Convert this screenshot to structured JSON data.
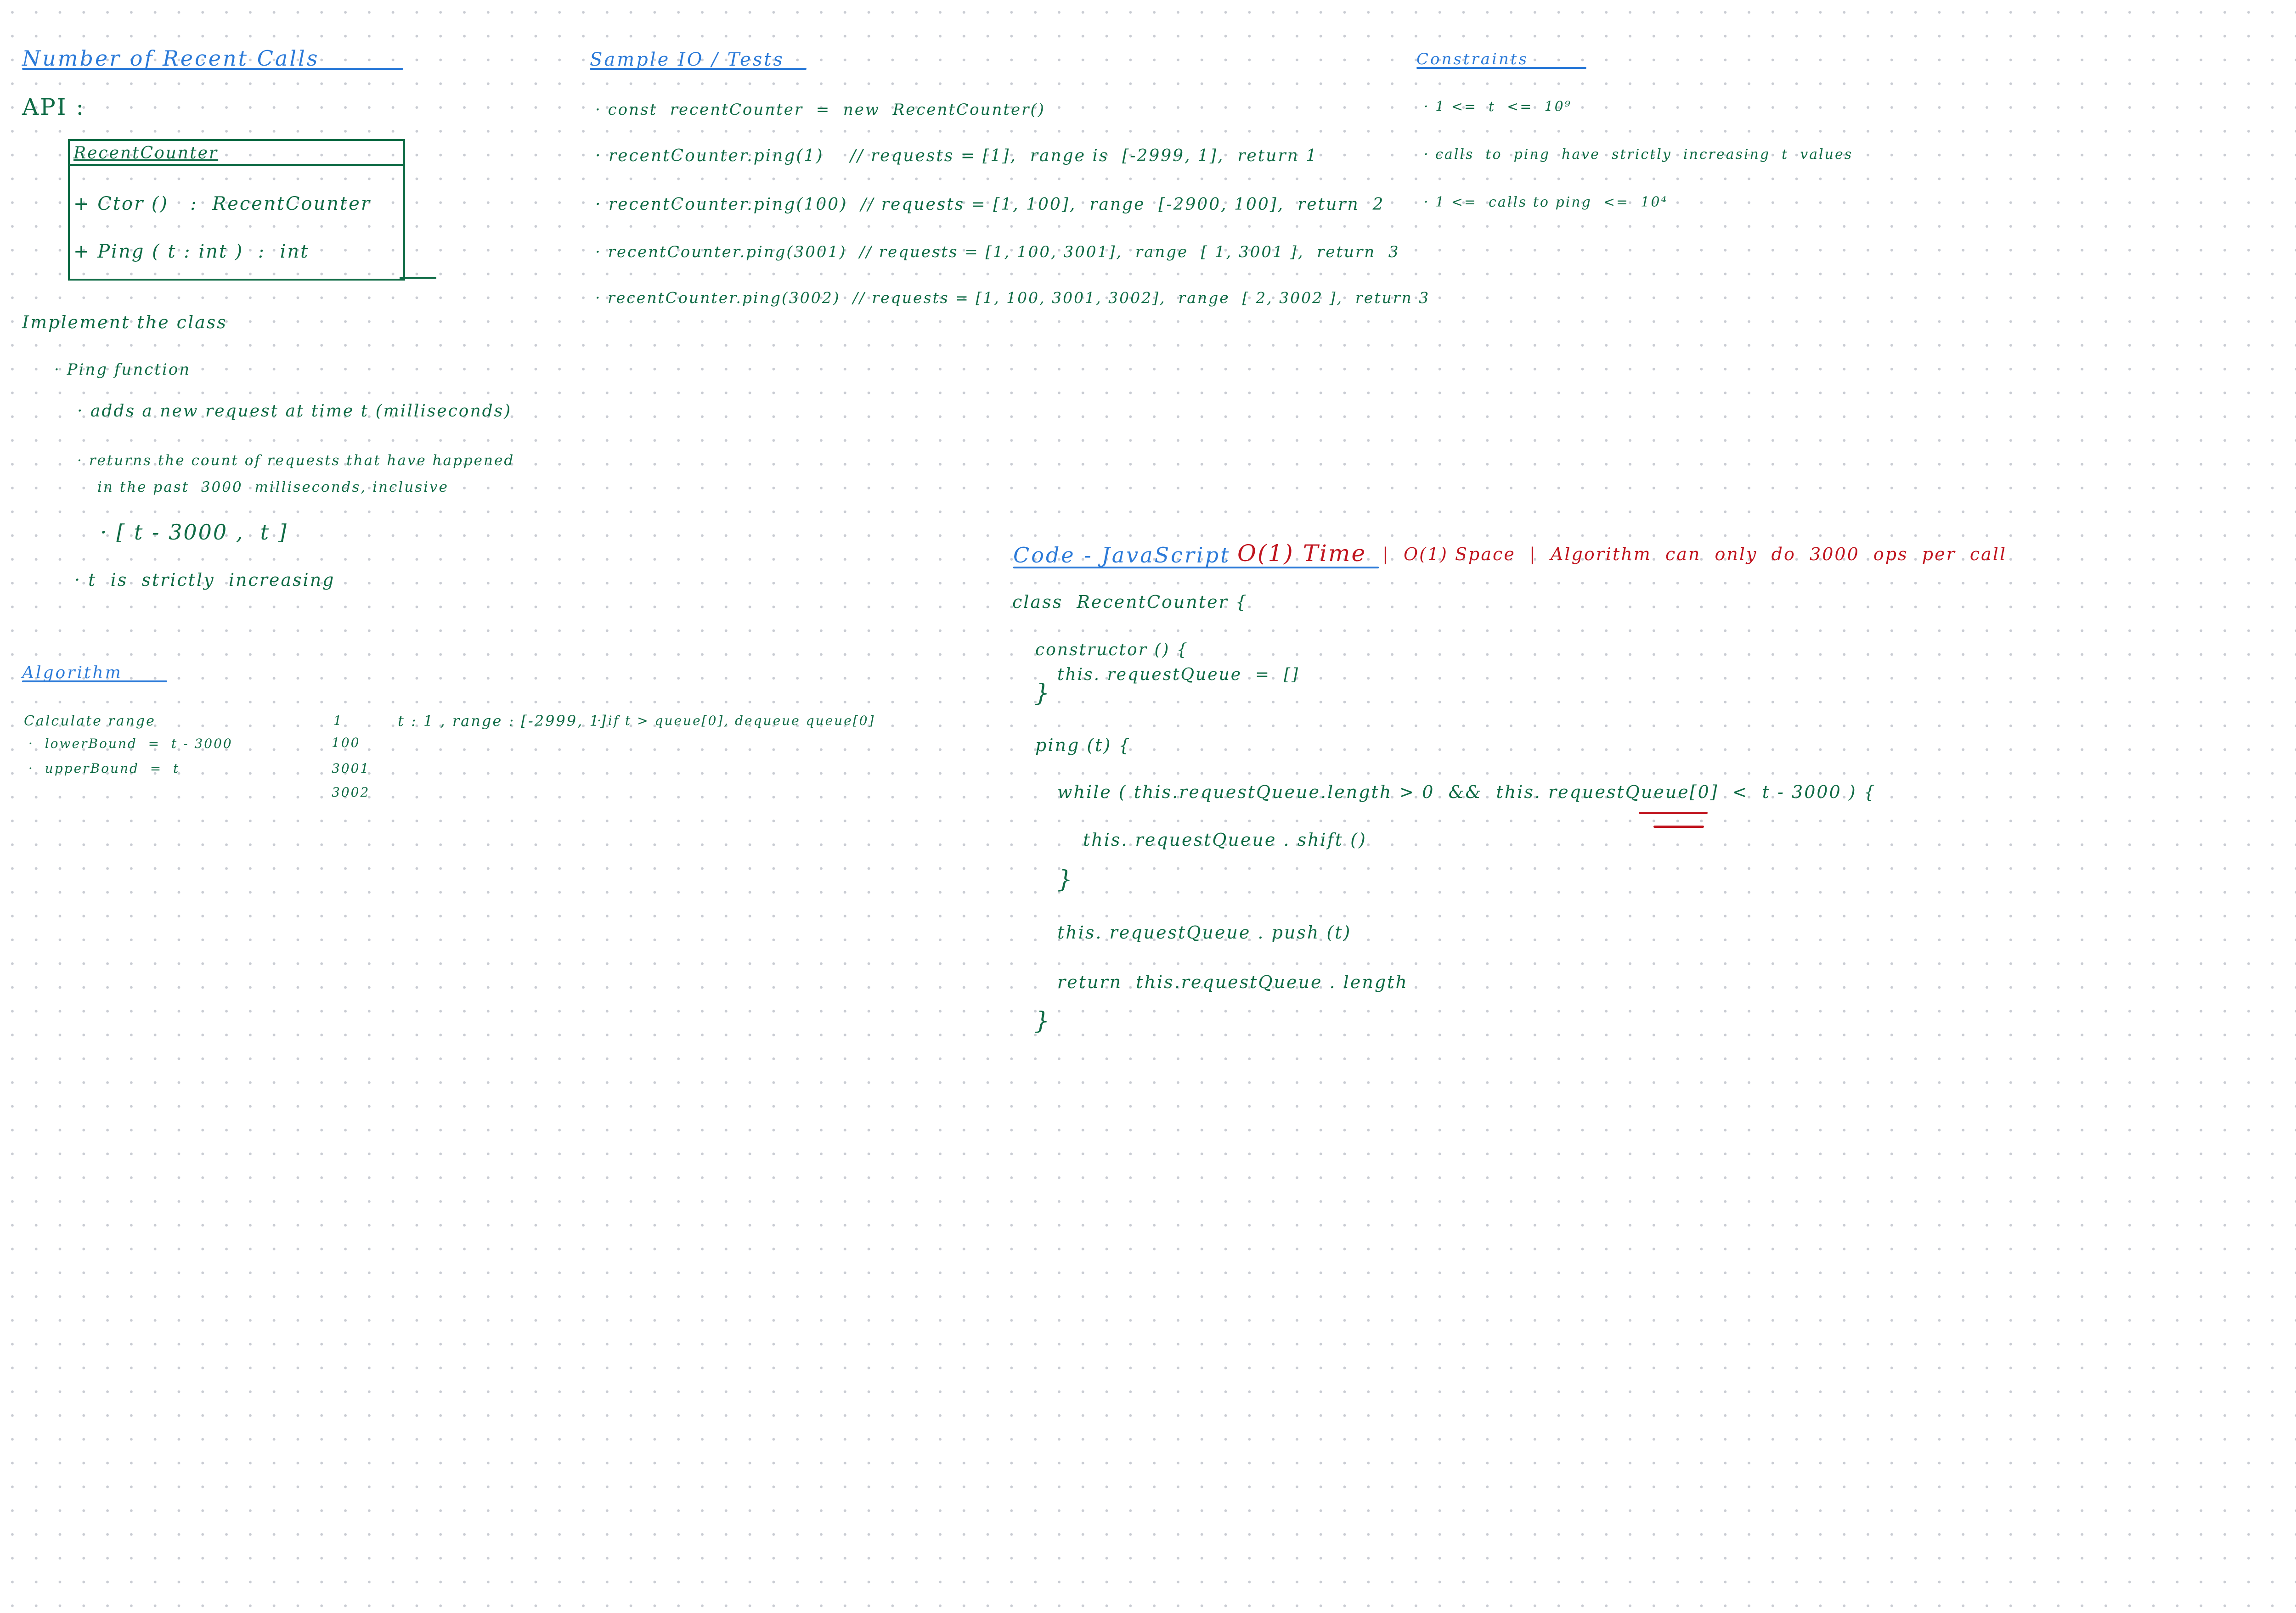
{
  "colors": {
    "ink_green": "#0f6b45",
    "ink_blue": "#2b7ad8",
    "ink_red": "#c0141e",
    "grid_dot": "#c9ccd3"
  },
  "title": "Number of Recent Calls",
  "api": {
    "label": "API :",
    "class_name": "RecentCounter",
    "members": [
      "+ Ctor ()   :  RecentCounter",
      "+ Ping ( t : int )  :  int"
    ]
  },
  "implement": {
    "heading": "Implement the class",
    "items": [
      "· Ping function",
      "· adds a new request at time t (milliseconds)",
      "· returns the count of requests that have happened",
      "in the past  3000  milliseconds, inclusive",
      "· [ t - 3000 ,  t ]",
      "· t  is  strictly  increasing"
    ]
  },
  "algorithm": {
    "heading": "Algorithm",
    "calc_range": "Calculate range",
    "lower": "·  lowerBound  =  t - 3000",
    "upper": "·  upperBound  =  t",
    "times": [
      "1",
      "100",
      "3001",
      "3002"
    ],
    "example": "t : 1 , range : [-2999, 1]",
    "dequeue": "· if t > queue[0], dequeue queue[0]"
  },
  "tests": {
    "heading": "Sample IO / Tests",
    "lines": [
      "· const  recentCounter  =  new  RecentCounter()",
      "· recentCounter.ping(1)    // requests = [1],  range is  [-2999, 1],  return 1",
      "· recentCounter.ping(100)  // requests = [1, 100],  range  [-2900, 100],  return  2",
      "· recentCounter.ping(3001)  // requests = [1, 100, 3001],  range  [ 1, 3001 ],  return  3",
      "· recentCounter.ping(3002)  // requests = [1, 100, 3001, 3002],  range  [ 2, 3002 ],  return 3"
    ]
  },
  "constraints": {
    "heading": "Constraints",
    "items": [
      "· 1 <=  t  <=  10⁹",
      "· calls  to  ping  have  strictly  increasing  t  values",
      "· 1 <=  calls to ping  <=  10⁴"
    ]
  },
  "code": {
    "heading": "Code - JavaScript",
    "complexity_time": "O(1) Time",
    "complexity_rest": "|  O(1) Space  |  Algorithm  can  only  do  3000  ops  per  call",
    "lines": [
      "class  RecentCounter {",
      "constructor () {",
      "this. requestQueue  =  []",
      "}",
      "ping (t) {",
      "while ( this.requestQueue.length > 0  &&  this. requestQueue[0]  <  t - 3000 ) {",
      "this. requestQueue . shift ()",
      "}",
      "this. requestQueue . push (t)",
      "return  this.requestQueue . length",
      "}"
    ]
  }
}
